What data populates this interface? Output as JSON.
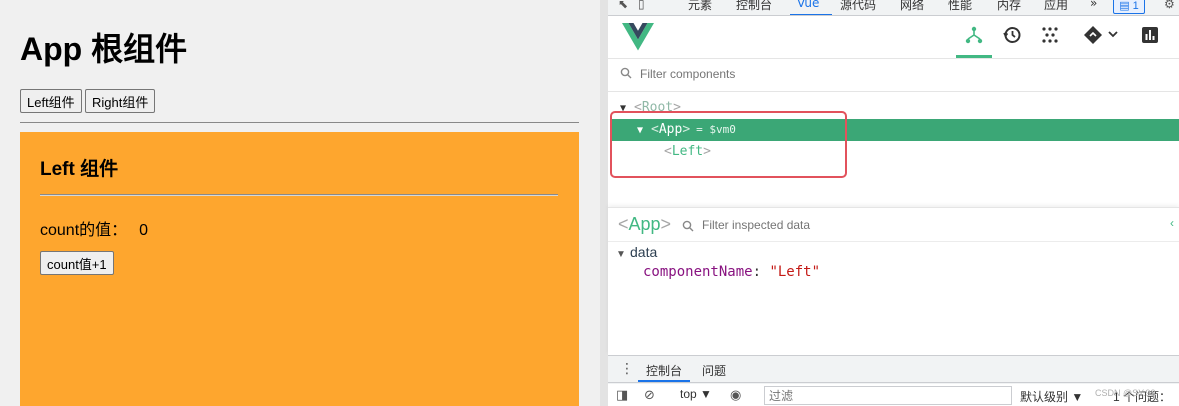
{
  "preview": {
    "title": "App 根组件",
    "nav_buttons": [
      "Left组件",
      "Right组件"
    ],
    "left_panel": {
      "title": "Left 组件",
      "count_label": "count的值：",
      "count_value": "0",
      "increment_button": "count值+1",
      "background_color": "#fea62e"
    }
  },
  "devtools": {
    "tabs": [
      "元素",
      "控制台",
      "Vue",
      "源代码",
      "网络",
      "性能",
      "内存",
      "应用"
    ],
    "active_tab": "Vue",
    "more_tabs_glyph": "»",
    "issues_badge": "1",
    "vue": {
      "toolbar_icons": [
        "component-tree-icon",
        "timeline-icon",
        "plugins-icon",
        "routes-icon",
        "settings-chart-icon"
      ],
      "filter_placeholder": "Filter components",
      "tree": {
        "root": "Root",
        "selected": {
          "name": "App",
          "vm": "= $vm0"
        },
        "child": "Left"
      },
      "inspector": {
        "component": "App",
        "filter_placeholder": "Filter inspected data",
        "section": "data",
        "property": {
          "key": "componentName",
          "value": "\"Left\""
        }
      },
      "accent_color": "#42b883",
      "selected_row_color": "#3ba776",
      "highlight_color": "#e2525c"
    },
    "drawer": {
      "tabs": [
        "控制台",
        "问题"
      ],
      "context": "top ▼",
      "filter_placeholder": "过滤",
      "log_level": "默认级别 ▼",
      "issue_count": "1 个问题："
    }
  },
  "watermark": "CSDN @SY.93"
}
